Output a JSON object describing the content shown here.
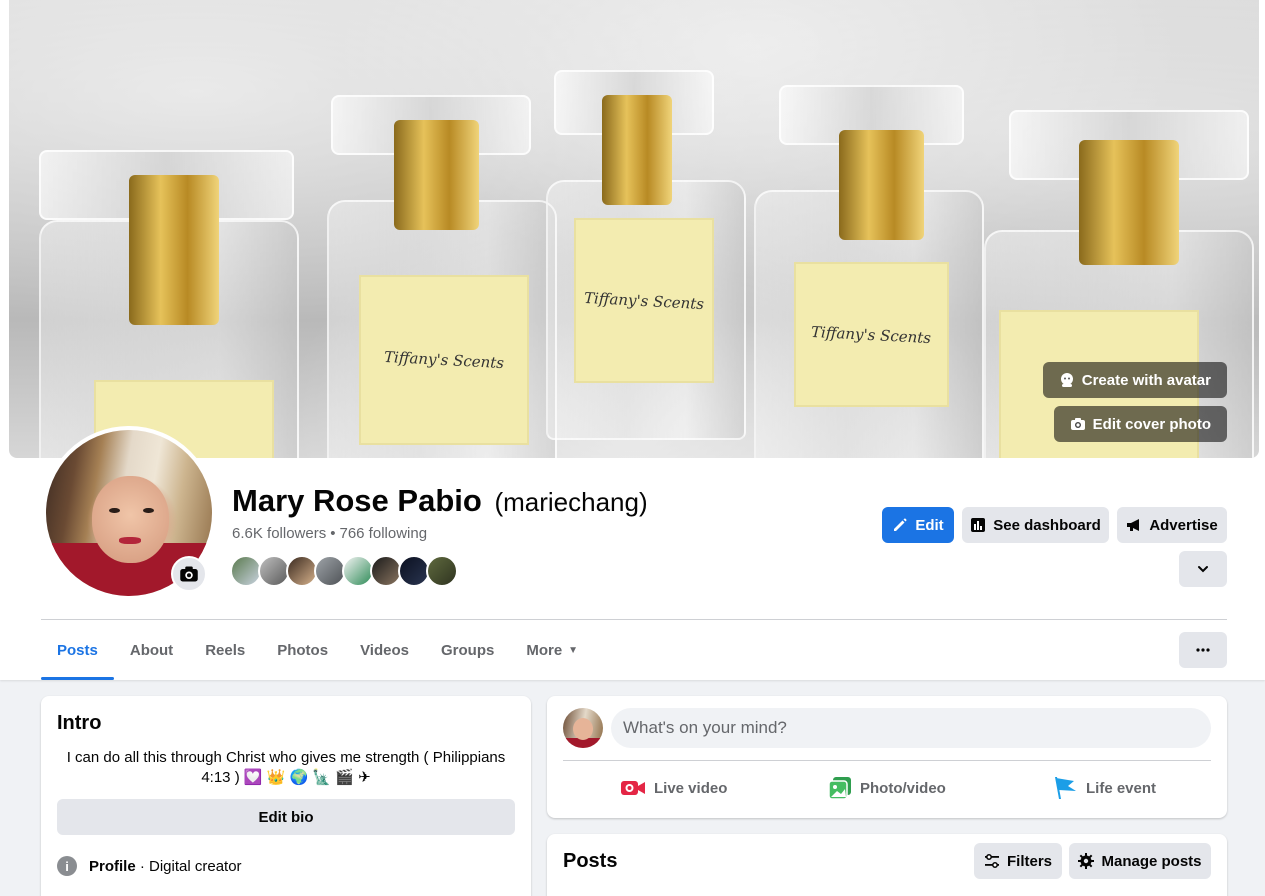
{
  "cover": {
    "create_avatar_label": "Create with avatar",
    "edit_cover_label": "Edit cover photo",
    "bottle_label_text": "Tiffany's Scents"
  },
  "profile": {
    "name": "Mary Rose Pabio",
    "alternate_name": "(mariechang)",
    "followers": "6.6K followers",
    "separator": "•",
    "following": "766 following"
  },
  "actions": {
    "edit_label": "Edit",
    "dashboard_label": "See dashboard",
    "advertise_label": "Advertise"
  },
  "tabs": [
    {
      "label": "Posts",
      "active": true
    },
    {
      "label": "About"
    },
    {
      "label": "Reels"
    },
    {
      "label": "Photos"
    },
    {
      "label": "Videos"
    },
    {
      "label": "Groups"
    },
    {
      "label": "More"
    }
  ],
  "intro": {
    "title": "Intro",
    "bio": "I can do all this through Christ who gives me strength ( Philippians 4:13 ) 💟 👑 🌍 🗽 🎬 ✈",
    "edit_bio_label": "Edit bio",
    "profile_label": "Profile",
    "profile_value": " · Digital creator"
  },
  "composer": {
    "placeholder": "What's on your mind?",
    "live_video": "Live video",
    "photo_video": "Photo/video",
    "life_event": "Life event"
  },
  "posts": {
    "title": "Posts",
    "filters_label": "Filters",
    "manage_label": "Manage posts"
  },
  "colors": {
    "accent": "#1b74e4",
    "live": "#e42645",
    "photo": "#45bd62",
    "life_event": "#1b9ee7"
  }
}
